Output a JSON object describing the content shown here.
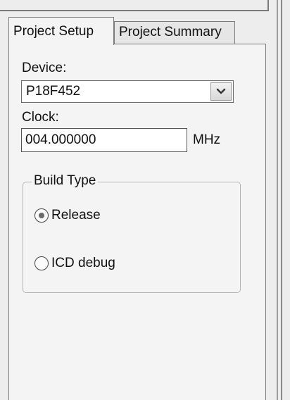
{
  "tabs": [
    {
      "label": "Project Setup",
      "active": true
    },
    {
      "label": "Project Summary",
      "active": false
    }
  ],
  "device": {
    "label": "Device:",
    "value": "P18F452",
    "dropdown_icon": "chevron-down-icon"
  },
  "clock": {
    "label": "Clock:",
    "value": "004.000000",
    "unit": "MHz"
  },
  "build_type": {
    "legend": "Build Type",
    "options": [
      {
        "label": "Release",
        "selected": true
      },
      {
        "label": "ICD debug",
        "selected": false
      }
    ]
  }
}
